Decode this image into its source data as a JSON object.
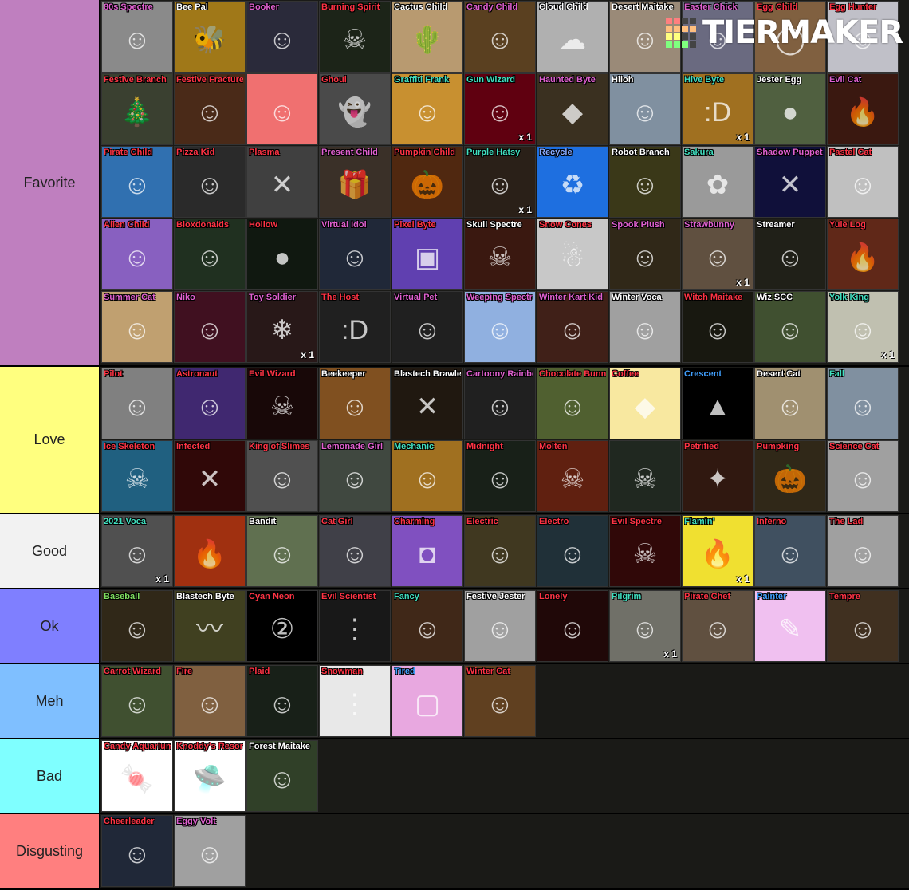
{
  "watermark": {
    "text": "TIERMAKER",
    "grid_colors": [
      "#ff7f7f",
      "#ff7f7f",
      "#444",
      "#444",
      "#ffbf7f",
      "#ffbf7f",
      "#ffbf7f",
      "#ffbf7f",
      "#ffff7f",
      "#ffff7f",
      "#444",
      "#444",
      "#7fff7f",
      "#7fff7f",
      "#7fff7f",
      "#444"
    ]
  },
  "tiers": [
    {
      "label": "Favorite",
      "color": "#bf7fbf",
      "items": [
        {
          "name": "80s Spectre",
          "color": "#e060d0",
          "bg": "#8a8a8a",
          "glyph": "☺"
        },
        {
          "name": "Bee Pal",
          "color": "#ffffff",
          "bg": "#a07818",
          "glyph": "🐝"
        },
        {
          "name": "Booker",
          "color": "#e060d0",
          "bg": "#2a2a3a",
          "glyph": "☺"
        },
        {
          "name": "Burning Spirit",
          "color": "#ff3344",
          "bg": "#1c2418",
          "glyph": "☠"
        },
        {
          "name": "Cactus Child",
          "color": "#ffffff",
          "bg": "#b89a70",
          "glyph": "🌵"
        },
        {
          "name": "Candy Child",
          "color": "#e060d0",
          "bg": "#5a4020",
          "glyph": "☺"
        },
        {
          "name": "Cloud Child",
          "color": "#ffffff",
          "bg": "#b0b0b0",
          "glyph": "☁"
        },
        {
          "name": "Desert Maitake",
          "color": "#ffffff",
          "bg": "#9a8a78",
          "glyph": "☺"
        },
        {
          "name": "Easter Chick",
          "color": "#e060d0",
          "bg": "#6a6a80",
          "glyph": "☺"
        },
        {
          "name": "Egg Child",
          "color": "#ff3344",
          "bg": "#806040",
          "glyph": "◯"
        },
        {
          "name": "Egg Hunter",
          "color": "#ff3344",
          "bg": "#c0c0c8",
          "glyph": "☺"
        },
        {
          "name": "Festive Branch",
          "color": "#ff3344",
          "bg": "#3a4030",
          "glyph": "🎄"
        },
        {
          "name": "Festive Fracture",
          "color": "#ff3344",
          "bg": "#4a2a18",
          "glyph": "☺"
        },
        {
          "name": "",
          "color": "#ffffff",
          "bg": "#f07070",
          "glyph": "☺"
        },
        {
          "name": "Ghoul",
          "color": "#ff3344",
          "bg": "#4a4a4a",
          "glyph": "👻"
        },
        {
          "name": "Graffiti Frank",
          "color": "#40e0c0",
          "bg": "#c89030",
          "glyph": "☺"
        },
        {
          "name": "Gun Wizard",
          "color": "#40e0c0",
          "bg": "#600010",
          "glyph": "☺",
          "count": "x 1"
        },
        {
          "name": "Haunted Byte",
          "color": "#e060d0",
          "bg": "#3a3020",
          "glyph": "◆"
        },
        {
          "name": "Hiloh",
          "color": "#ffffff",
          "bg": "#8090a0",
          "glyph": "☺"
        },
        {
          "name": "Hive Byte",
          "color": "#40e0c0",
          "bg": "#a07020",
          "glyph": ":D",
          "count": "x 1"
        },
        {
          "name": "Jester Egg",
          "color": "#ffffff",
          "bg": "#506040",
          "glyph": "●"
        },
        {
          "name": "Evil Cat",
          "color": "#e060d0",
          "bg": "#3a1810",
          "glyph": "🔥"
        },
        {
          "name": "Pirate Child",
          "color": "#ff3344",
          "bg": "#3070b0",
          "glyph": "☺"
        },
        {
          "name": "Pizza Kid",
          "color": "#ff3344",
          "bg": "#2a2a2a",
          "glyph": "☺"
        },
        {
          "name": "Plasma",
          "color": "#ff3344",
          "bg": "#404040",
          "glyph": "✕"
        },
        {
          "name": "Present Child",
          "color": "#e060d0",
          "bg": "#3a3028",
          "glyph": "🎁"
        },
        {
          "name": "Pumpkin Child",
          "color": "#ff3344",
          "bg": "#502810",
          "glyph": "🎃"
        },
        {
          "name": "Purple Hatsy",
          "color": "#40e0c0",
          "bg": "#2a2018",
          "glyph": "☺",
          "count": "x 1"
        },
        {
          "name": "Recycle",
          "color": "#88aaff",
          "bg": "#1e6fe0",
          "glyph": "♻"
        },
        {
          "name": "Robot Branch",
          "color": "#ffffff",
          "bg": "#3a3818",
          "glyph": "☺"
        },
        {
          "name": "Sakura",
          "color": "#40e0c0",
          "bg": "#9a9a9a",
          "glyph": "✿"
        },
        {
          "name": "Shadow Puppet",
          "color": "#e060d0",
          "bg": "#10103a",
          "glyph": "✕"
        },
        {
          "name": "Pastel Cat",
          "color": "#ff3344",
          "bg": "#c0c0c0",
          "glyph": "☺"
        },
        {
          "name": "Alien Child",
          "color": "#ff3344",
          "bg": "#8860c0",
          "glyph": "☺"
        },
        {
          "name": "Bloxdonalds",
          "color": "#ff3344",
          "bg": "#203020",
          "glyph": "☺"
        },
        {
          "name": "Hollow",
          "color": "#ff3344",
          "bg": "#101810",
          "glyph": "●"
        },
        {
          "name": "Virtual Idol",
          "color": "#e060d0",
          "bg": "#202838",
          "glyph": "☺"
        },
        {
          "name": "Pixel Byte",
          "color": "#ff3344",
          "bg": "#6040b0",
          "glyph": "▣"
        },
        {
          "name": "Skull Spectre",
          "color": "#ffffff",
          "bg": "#3a1810",
          "glyph": "☠"
        },
        {
          "name": "Snow Cones",
          "color": "#ff3344",
          "bg": "#c8c8c8",
          "glyph": "☃"
        },
        {
          "name": "Spook Plush",
          "color": "#e060d0",
          "bg": "#302818",
          "glyph": "☺"
        },
        {
          "name": "Strawbunny",
          "color": "#e060d0",
          "bg": "#605040",
          "glyph": "☺",
          "count": "x 1"
        },
        {
          "name": "Streamer",
          "color": "#ffffff",
          "bg": "#202018",
          "glyph": "☺"
        },
        {
          "name": "Yule Log",
          "color": "#ff3344",
          "bg": "#602818",
          "glyph": "🔥"
        },
        {
          "name": "Summer Cat",
          "color": "#e060d0",
          "bg": "#c0a070",
          "glyph": "☺"
        },
        {
          "name": "Niko",
          "color": "#e060d0",
          "bg": "#401020",
          "glyph": "☺"
        },
        {
          "name": "Toy Soldier",
          "color": "#e060d0",
          "bg": "#281818",
          "glyph": "❄",
          "count": "x 1"
        },
        {
          "name": "The Host",
          "color": "#ff3344",
          "bg": "#202020",
          "glyph": ":D"
        },
        {
          "name": "Virtual Pet",
          "color": "#e060d0",
          "bg": "#202020",
          "glyph": "☺"
        },
        {
          "name": "Weeping Spectre",
          "color": "#e060d0",
          "bg": "#90b0e0",
          "glyph": "☺"
        },
        {
          "name": "Winter Kart Kid",
          "color": "#e060d0",
          "bg": "#402018",
          "glyph": "☺"
        },
        {
          "name": "Winter Voca",
          "color": "#ffffff",
          "bg": "#a0a0a0",
          "glyph": "☺"
        },
        {
          "name": "Witch Maitake",
          "color": "#ff3344",
          "bg": "#181810",
          "glyph": "☺"
        },
        {
          "name": "Wiz SCC",
          "color": "#ffffff",
          "bg": "#405030",
          "glyph": "☺"
        },
        {
          "name": "Yolk King",
          "color": "#40e0c0",
          "bg": "#c0c0b0",
          "glyph": "☺",
          "count": "x 1"
        }
      ]
    },
    {
      "label": "Love",
      "color": "#ffff7f",
      "items": [
        {
          "name": "Pilot",
          "color": "#ff3344",
          "bg": "#808080",
          "glyph": "☺"
        },
        {
          "name": "Astronaut",
          "color": "#ff3344",
          "bg": "#402870",
          "glyph": "☺"
        },
        {
          "name": "Evil Wizard",
          "color": "#ff3344",
          "bg": "#180808",
          "glyph": "☠"
        },
        {
          "name": "Beekeeper",
          "color": "#ffffff",
          "bg": "#805020",
          "glyph": "☺"
        },
        {
          "name": "Blastech Brawler",
          "color": "#ffffff",
          "bg": "#201810",
          "glyph": "✕"
        },
        {
          "name": "Cartoony Rainbow Wizard",
          "color": "#e060d0",
          "bg": "#202020",
          "glyph": "☺"
        },
        {
          "name": "Chocolate Bunny",
          "color": "#ff3344",
          "bg": "#506030",
          "glyph": "☺"
        },
        {
          "name": "Coffee",
          "color": "#ff3344",
          "bg": "#f8e8a0",
          "glyph": "◆"
        },
        {
          "name": "Crescent",
          "color": "#40a0ff",
          "bg": "#000000",
          "glyph": "▲"
        },
        {
          "name": "Desert Cat",
          "color": "#ffffff",
          "bg": "#a09070",
          "glyph": "☺"
        },
        {
          "name": "Fall",
          "color": "#40e0c0",
          "bg": "#8090a0",
          "glyph": "☺"
        },
        {
          "name": "Ice Skeleton",
          "color": "#ff3344",
          "bg": "#206080",
          "glyph": "☠"
        },
        {
          "name": "Infected",
          "color": "#ff3344",
          "bg": "#300808",
          "glyph": "✕"
        },
        {
          "name": "King of Slimes",
          "color": "#ff3344",
          "bg": "#505050",
          "glyph": "☺"
        },
        {
          "name": "Lemonade Girl",
          "color": "#e060d0",
          "bg": "#404840",
          "glyph": "☺"
        },
        {
          "name": "Mechanic",
          "color": "#40e0c0",
          "bg": "#a07020",
          "glyph": "☺"
        },
        {
          "name": "Midnight",
          "color": "#ff3344",
          "bg": "#182018",
          "glyph": "☺"
        },
        {
          "name": "Molten",
          "color": "#ff3344",
          "bg": "#602010",
          "glyph": "☠"
        },
        {
          "name": "",
          "color": "#ffffff",
          "bg": "#202820",
          "glyph": "☠"
        },
        {
          "name": "Petrified",
          "color": "#ff3344",
          "bg": "#301810",
          "glyph": "✦"
        },
        {
          "name": "Pumpking",
          "color": "#ff3344",
          "bg": "#302818",
          "glyph": "🎃"
        },
        {
          "name": "Science Cat",
          "color": "#ff3344",
          "bg": "#a0a0a0",
          "glyph": "☺"
        }
      ]
    },
    {
      "label": "Good",
      "color": "#f2f2f2",
      "items": [
        {
          "name": "2021 Voca",
          "color": "#40e0c0",
          "bg": "#505050",
          "glyph": "☺",
          "count": "x 1"
        },
        {
          "name": "",
          "color": "#ffffff",
          "bg": "#a03010",
          "glyph": "🔥"
        },
        {
          "name": "Bandit",
          "color": "#ffffff",
          "bg": "#607050",
          "glyph": "☺"
        },
        {
          "name": "Cat Girl",
          "color": "#ff3344",
          "bg": "#404048",
          "glyph": "☺"
        },
        {
          "name": "Charming",
          "color": "#ff3344",
          "bg": "#8050c0",
          "glyph": "◘"
        },
        {
          "name": "Electric",
          "color": "#ff3344",
          "bg": "#403820",
          "glyph": "☺"
        },
        {
          "name": "Electro",
          "color": "#ff3344",
          "bg": "#203038",
          "glyph": "☺"
        },
        {
          "name": "Evil Spectre",
          "color": "#ff3344",
          "bg": "#300808",
          "glyph": "☠"
        },
        {
          "name": "Flamin'",
          "color": "#40e0c0",
          "bg": "#f0e030",
          "glyph": "🔥",
          "count": "x 1"
        },
        {
          "name": "Inferno",
          "color": "#ff3344",
          "bg": "#405060",
          "glyph": "☺"
        },
        {
          "name": "The Lad",
          "color": "#ff3344",
          "bg": "#a0a0a0",
          "glyph": "☺"
        }
      ]
    },
    {
      "label": "Ok",
      "color": "#7f7fff",
      "items": [
        {
          "name": "Baseball",
          "color": "#80e060",
          "bg": "#302818",
          "glyph": "☺"
        },
        {
          "name": "Blastech Byte",
          "color": "#ffffff",
          "bg": "#404020",
          "glyph": "〰"
        },
        {
          "name": "Cyan Neon",
          "color": "#ff3344",
          "bg": "#000000",
          "glyph": "②"
        },
        {
          "name": "Evil Scientist",
          "color": "#ff3344",
          "bg": "#181818",
          "glyph": "⋮"
        },
        {
          "name": "Fancy",
          "color": "#40e0c0",
          "bg": "#402818",
          "glyph": "☺"
        },
        {
          "name": "Festive Jester",
          "color": "#ffffff",
          "bg": "#a0a0a0",
          "glyph": "☺"
        },
        {
          "name": "Lonely",
          "color": "#ff3344",
          "bg": "#200808",
          "glyph": "☺"
        },
        {
          "name": "Pilgrim",
          "color": "#40e0c0",
          "bg": "#707068",
          "glyph": "☺",
          "count": "x 1"
        },
        {
          "name": "Pirate Chef",
          "color": "#ff3344",
          "bg": "#605040",
          "glyph": "☺"
        },
        {
          "name": "Painter",
          "color": "#40a0ff",
          "bg": "#f0c0f0",
          "glyph": "✎"
        },
        {
          "name": "Tempre",
          "color": "#ff3344",
          "bg": "#403020",
          "glyph": "☺"
        }
      ]
    },
    {
      "label": "Meh",
      "color": "#7fbfff",
      "items": [
        {
          "name": "Carrot Wizard",
          "color": "#ff3344",
          "bg": "#405030",
          "glyph": "☺"
        },
        {
          "name": "Fire",
          "color": "#ff3344",
          "bg": "#806040",
          "glyph": "☺"
        },
        {
          "name": "Plaid",
          "color": "#ff3344",
          "bg": "#182018",
          "glyph": "☺"
        },
        {
          "name": "Snowman",
          "color": "#ff3344",
          "bg": "#e8e8e8",
          "glyph": "⋮"
        },
        {
          "name": "Tired",
          "color": "#40a0ff",
          "bg": "#e8a8e0",
          "glyph": "▢"
        },
        {
          "name": "Winter Cat",
          "color": "#ff3344",
          "bg": "#604020",
          "glyph": "☺"
        }
      ]
    },
    {
      "label": "Bad",
      "color": "#7fffff",
      "items": [
        {
          "name": "Candy Aquarium",
          "color": "#ff3344",
          "bg": "#ffffff",
          "glyph": "🍬"
        },
        {
          "name": "Knoddy's Resort",
          "color": "#ff3344",
          "bg": "#ffffff",
          "glyph": "🛸"
        },
        {
          "name": "Forest Maitake",
          "color": "#ffffff",
          "bg": "#304028",
          "glyph": "☺"
        }
      ]
    },
    {
      "label": "Disgusting",
      "color": "#ff7f7f",
      "items": [
        {
          "name": "Cheerleader",
          "color": "#ff3344",
          "bg": "#202838",
          "glyph": "☺"
        },
        {
          "name": "Eggy Volt",
          "color": "#e060d0",
          "bg": "#a0a0a0",
          "glyph": "☺"
        }
      ]
    }
  ]
}
